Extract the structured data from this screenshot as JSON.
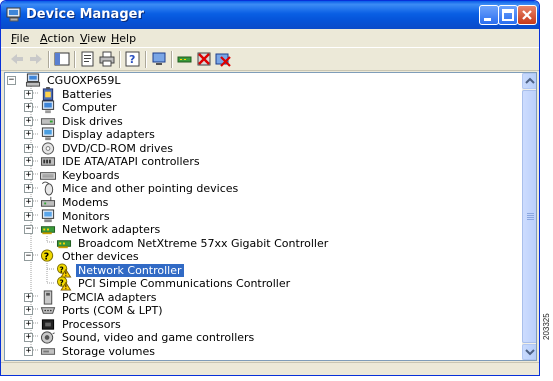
{
  "window": {
    "title": "Device Manager",
    "title_icon": "device-manager-icon"
  },
  "menu": [
    {
      "label": "File",
      "key": "F",
      "rest": "ile"
    },
    {
      "label": "Action",
      "key": "A",
      "rest": "ction"
    },
    {
      "label": "View",
      "key": "V",
      "rest": "iew"
    },
    {
      "label": "Help",
      "key": "H",
      "rest": "elp"
    }
  ],
  "toolbar": [
    "back-arrow-icon",
    "forward-arrow-icon",
    "show-hide-console-tree-icon",
    "properties-icon",
    "print-icon",
    "help-icon",
    "scan-hardware-icon",
    "update-driver-icon",
    "uninstall-icon",
    "disable-icon"
  ],
  "tree": {
    "root": "CGUOXP659L",
    "items": [
      {
        "label": "Batteries",
        "icon": "battery-icon",
        "expander": "+"
      },
      {
        "label": "Computer",
        "icon": "computer-icon",
        "expander": "+"
      },
      {
        "label": "Disk drives",
        "icon": "disk-drive-icon",
        "expander": "+"
      },
      {
        "label": "Display adapters",
        "icon": "display-adapter-icon",
        "expander": "+"
      },
      {
        "label": "DVD/CD-ROM drives",
        "icon": "cdrom-icon",
        "expander": "+"
      },
      {
        "label": "IDE ATA/ATAPI controllers",
        "icon": "ide-controller-icon",
        "expander": "+"
      },
      {
        "label": "Keyboards",
        "icon": "keyboard-icon",
        "expander": "+"
      },
      {
        "label": "Mice and other pointing devices",
        "icon": "mouse-icon",
        "expander": "+"
      },
      {
        "label": "Modems",
        "icon": "modem-icon",
        "expander": "+"
      },
      {
        "label": "Monitors",
        "icon": "monitor-icon",
        "expander": "+"
      },
      {
        "label": "Network adapters",
        "icon": "network-adapter-icon",
        "expander": "-",
        "children": [
          {
            "label": "Broadcom NetXtreme 57xx Gigabit Controller",
            "icon": "network-card-icon"
          }
        ]
      },
      {
        "label": "Other devices",
        "icon": "unknown-device-icon",
        "expander": "-",
        "children": [
          {
            "label": "Network Controller",
            "icon": "warning-device-icon",
            "selected": true
          },
          {
            "label": "PCI Simple Communications Controller",
            "icon": "warning-device-icon"
          }
        ]
      },
      {
        "label": "PCMCIA adapters",
        "icon": "pcmcia-icon",
        "expander": "+"
      },
      {
        "label": "Ports (COM & LPT)",
        "icon": "port-icon",
        "expander": "+"
      },
      {
        "label": "Processors",
        "icon": "processor-icon",
        "expander": "+"
      },
      {
        "label": "Sound, video and game controllers",
        "icon": "sound-icon",
        "expander": "+"
      },
      {
        "label": "Storage volumes",
        "icon": "storage-volume-icon",
        "expander": "+"
      }
    ]
  },
  "side_label": "203325",
  "colors": {
    "title_bar": "#0a5fe4",
    "selection": "#316ac5",
    "chrome": "#ece9d8"
  }
}
